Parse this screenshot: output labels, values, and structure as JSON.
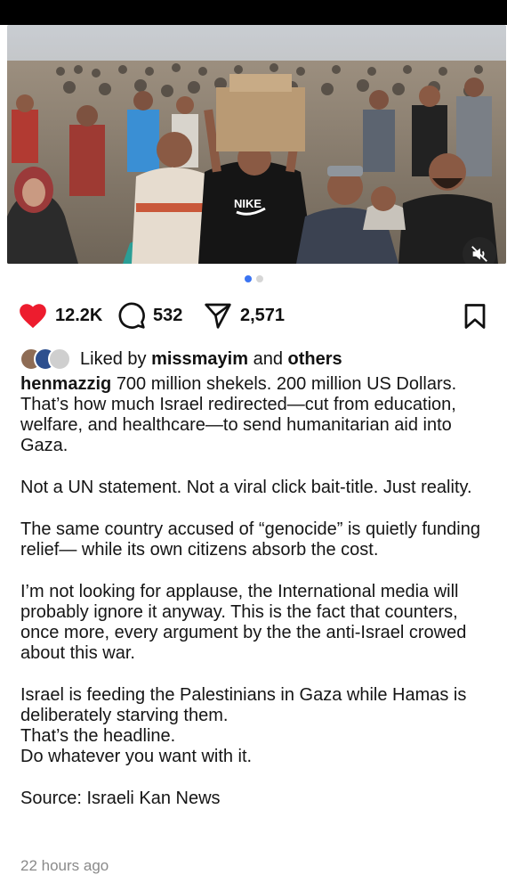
{
  "post": {
    "actions": {
      "likes": "12.2K",
      "comments": "532",
      "shares": "2,571"
    },
    "liked_by": {
      "prefix": "Liked by",
      "user": "missmayim",
      "conjunction": "and",
      "others": "others"
    },
    "author": "henmazzig",
    "caption_first": "700 million shekels. 200 million US Dollars. That’s how much Israel redirected—cut from education, welfare, and healthcare—to send humanitarian aid into Gaza.",
    "paragraph_2": "Not a UN statement. Not a viral click bait-title. Just reality.",
    "paragraph_3": "The same country accused of “genocide” is quietly funding relief— while its own citizens absorb the cost.",
    "paragraph_4": "I’m not looking for applause, the International media will probably ignore it anyway. This is the fact that counters, once more, every argument by the the anti-Israel crowed about this war.",
    "paragraph_5_lines": [
      "Israel is feeding the Palestinians in Gaza while Hamas is deliberately starving them.",
      "That’s the headline.",
      "Do whatever you want with it."
    ],
    "source": "Source: Israeli Kan News",
    "timestamp": "22 hours ago"
  },
  "carousel": {
    "total": 2,
    "active": 1
  },
  "icons": {
    "like": "heart-icon",
    "comment": "comment-bubble-icon",
    "share": "paper-plane-icon",
    "save": "bookmark-icon",
    "mute": "speaker-muted-icon"
  },
  "colors": {
    "like_red": "#ed1c2e",
    "dot_active": "#3b74f2",
    "dot_inactive": "#d6d6d6",
    "timestamp_gray": "#8a8a8a"
  }
}
